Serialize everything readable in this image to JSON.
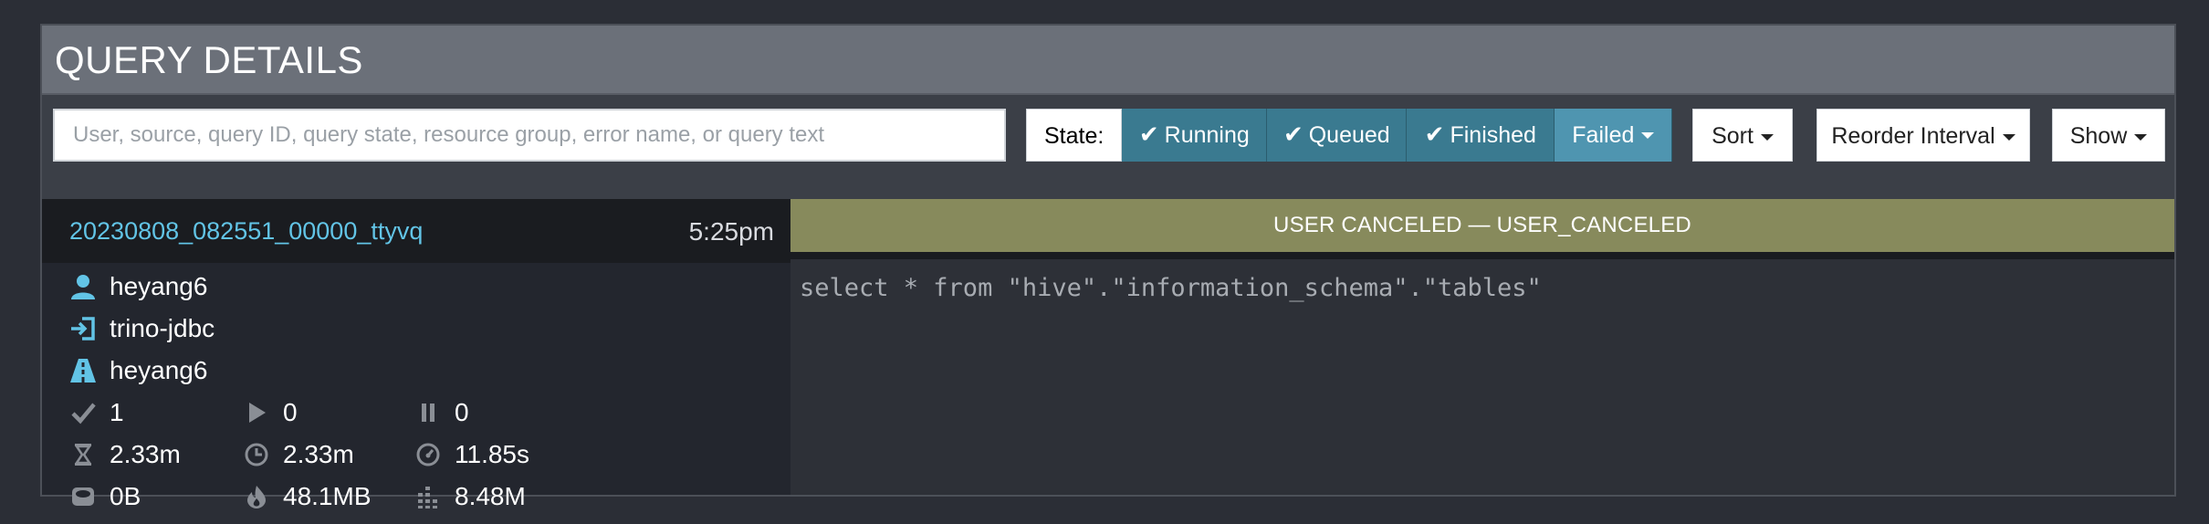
{
  "header": {
    "title": "QUERY DETAILS"
  },
  "toolbar": {
    "search_placeholder": "User, source, query ID, query state, resource group, error name, or query text",
    "state_label": "State:",
    "states": [
      {
        "label": "Running",
        "checked": true
      },
      {
        "label": "Queued",
        "checked": true
      },
      {
        "label": "Finished",
        "checked": true
      },
      {
        "label": "Failed",
        "checked": false,
        "has_dropdown": true
      }
    ],
    "sort_label": "Sort",
    "reorder_label": "Reorder Interval",
    "show_label": "Show"
  },
  "query": {
    "id": "20230808_082551_00000_ttyvq",
    "time": "5:25pm",
    "user": "heyang6",
    "source": "trino-jdbc",
    "resource_group": "heyang6",
    "stats": {
      "completed_splits": "1",
      "running_splits": "0",
      "queued_splits": "0",
      "wall_time": "2.33m",
      "elapsed_time": "2.33m",
      "cpu_time": "11.85s",
      "memory": "0B",
      "peak_memory": "48.1MB",
      "input_rows": "8.48M"
    },
    "state_banner": "USER CANCELED — USER_CANCELED",
    "sql": "select * from \"hive\".\"information_schema\".\"tables\""
  },
  "colors": {
    "accent": "#62c4e6",
    "state_button": "#3a7a90",
    "failed_button": "#4f95b0",
    "banner": "#878a5c"
  },
  "icons": [
    "user-icon",
    "login-icon",
    "road-icon",
    "check-icon",
    "play-icon",
    "pause-icon",
    "hourglass-icon",
    "clock-icon",
    "dashboard-icon",
    "hdd-icon",
    "fire-icon",
    "bar-chart-icon",
    "chevron-down-icon"
  ]
}
